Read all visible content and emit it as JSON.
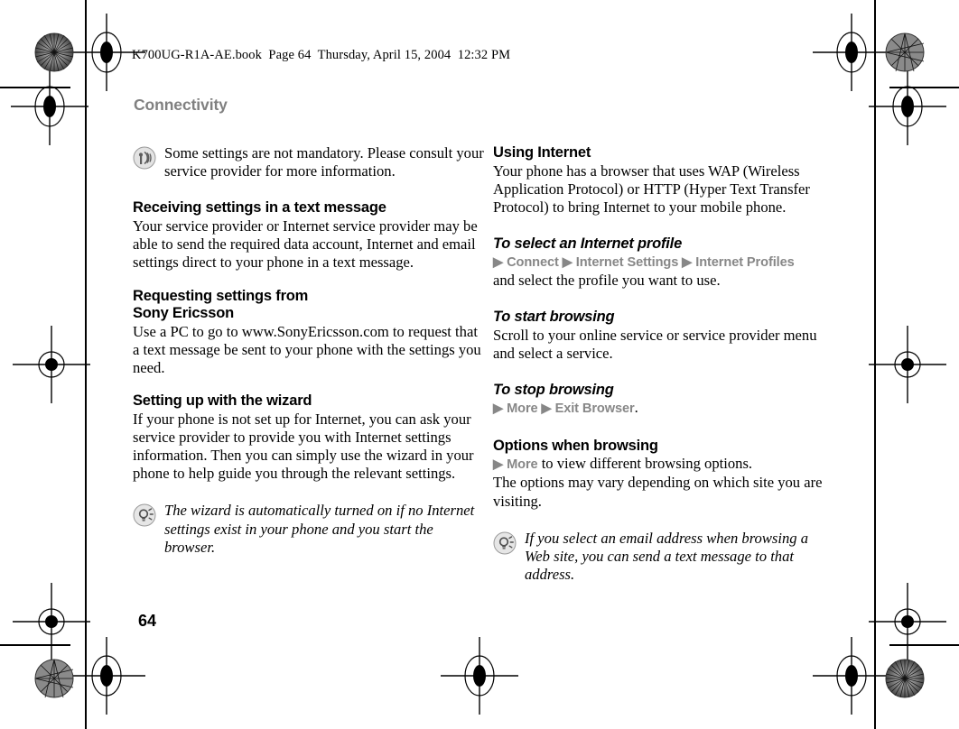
{
  "document": {
    "book_header": "K700UG-R1A-AE.book  Page 64  Thursday, April 15, 2004  12:32 PM",
    "running_head": "Connectivity",
    "page_number": "64"
  },
  "colors": {
    "running_head_gray": "#808080",
    "navpath_gray": "#878787",
    "body_black": "#000000",
    "page_background": "#ffffff"
  },
  "left_column": {
    "note_top": {
      "icon": "signal-note-icon",
      "text": "Some settings are not mandatory. Please consult your service provider for more information."
    },
    "sections": [
      {
        "heading": "Receiving settings in a text message",
        "body": "Your service provider or Internet service provider may be able to send the required data account, Internet and email settings direct to your phone in a text message."
      },
      {
        "heading": "Requesting settings from Sony Ericsson",
        "heading_line1": "Requesting settings from",
        "heading_line2": "Sony Ericsson",
        "body": "Use a PC to go to www.SonyEricsson.com to request that a text message be sent to your phone with the settings you need."
      },
      {
        "heading": "Setting up with the wizard",
        "body": "If your phone is not set up for Internet, you can ask your service provider to provide you with Internet settings information. Then you can simply use the wizard in your phone to help guide you through the relevant settings."
      }
    ],
    "note_bottom": {
      "icon": "tip-bulb-icon",
      "text": "The wizard is automatically turned on if no Internet settings exist in your phone and you start the browser."
    }
  },
  "right_column": {
    "sections": [
      {
        "heading": "Using Internet",
        "heading_style": "upright",
        "body": "Your phone has a browser that uses WAP (Wireless Application Protocol) or HTTP (Hyper Text Transfer Protocol) to bring Internet to your mobile phone."
      },
      {
        "heading": "To select an Internet profile",
        "heading_style": "italic",
        "navpath": "▶ Connect ▶ Internet Settings ▶ Internet Profiles",
        "navpath_items": [
          "Connect",
          "Internet Settings",
          "Internet Profiles"
        ],
        "body": "and select the profile you want to use."
      },
      {
        "heading": "To start browsing",
        "heading_style": "italic",
        "body": "Scroll to your online service or service provider menu and select a service."
      },
      {
        "heading": "To stop browsing",
        "heading_style": "italic",
        "navpath": "▶ More ▶ Exit Browser",
        "navpath_items": [
          "More",
          "Exit Browser"
        ],
        "navpath_tail": "."
      },
      {
        "heading": "Options when browsing",
        "heading_style": "upright",
        "navpath_lead": "▶ More",
        "navpath_tail": " to view different browsing options.",
        "body": "The options may vary depending on which site you are visiting."
      }
    ],
    "note_bottom": {
      "icon": "tip-bulb-icon",
      "text": "If you select an email address when browsing a Web site, you can send a text message to that address."
    }
  }
}
